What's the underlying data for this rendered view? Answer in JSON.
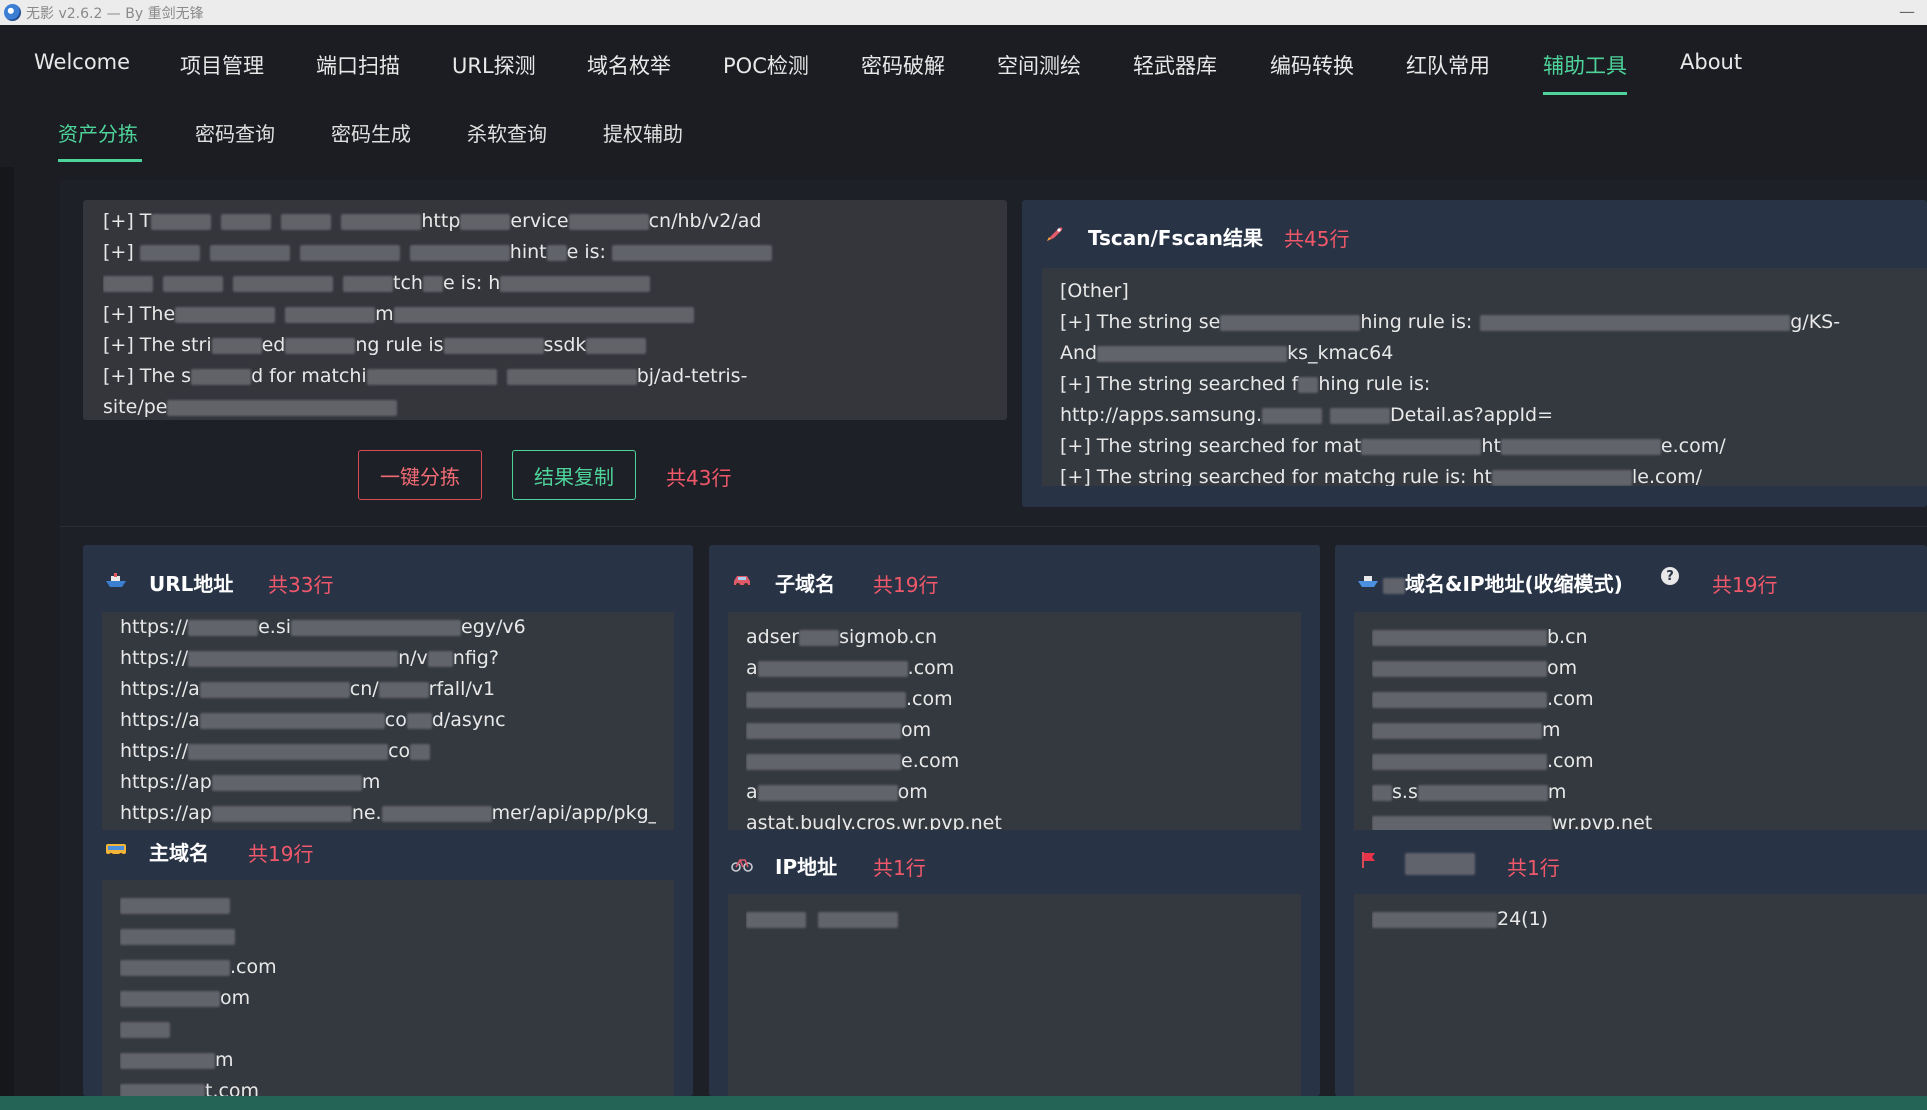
{
  "window": {
    "title": "无影 v2.6.2 — By 重剑无锋",
    "minimize": "—"
  },
  "topnav": {
    "items": [
      "Welcome",
      "项目管理",
      "端口扫描",
      "URL探测",
      "域名枚举",
      "POC检测",
      "密码破解",
      "空间测绘",
      "轻武器库",
      "编码转换",
      "红队常用",
      "辅助工具",
      "About"
    ],
    "active": "辅助工具"
  },
  "subnav": {
    "items": [
      "资产分拣",
      "密码查询",
      "密码生成",
      "杀软查询",
      "提权辅助"
    ],
    "active": "资产分拣"
  },
  "input": {
    "lines": [
      [
        "[+] T",
        "",
        "",
        "",
        "",
        "http",
        "",
        "ervice",
        "",
        "cn/hb/v2/ad"
      ],
      [
        "[+] ",
        "",
        "",
        "",
        "",
        "hint",
        "",
        "e is: ",
        ""
      ],
      [
        "",
        "",
        "",
        "",
        "tch",
        "",
        "e is: h",
        ""
      ],
      [
        "[+] ",
        "The",
        "",
        "",
        "m",
        ""
      ],
      [
        "[+] The stri",
        "",
        "ed",
        "",
        "ng rule is",
        "",
        "ssdk",
        ""
      ],
      [
        "[+] The s",
        "",
        "d for matchi",
        "",
        "",
        "bj/ad-tetris-"
      ],
      [
        "site/pe",
        ""
      ]
    ]
  },
  "actions": {
    "sort_label": "一键分拣",
    "copy_label": "结果复制",
    "count": "共43行"
  },
  "tscan": {
    "title": "Tscan/Fscan结果",
    "count": "共45行",
    "lines": [
      "[Other]",
      "[+] The string se",
      "hing rule is:",
      "g/KS-",
      "And",
      "ks_kmac64",
      "[+] The string searched f",
      "hing rule is:",
      "http://apps.samsung.",
      "Detail.as?appId=",
      "[+] The string searched for mat",
      "ht",
      "e.com/",
      "[+] The string searched for match",
      "g rule is: ht",
      "le.com/"
    ]
  },
  "panels": {
    "url": {
      "title": "URL地址",
      "count": "共33行",
      "lines": [
        [
          "https://",
          "e.si",
          "egy/v6"
        ],
        [
          "https://",
          "n/v",
          "nfig?"
        ],
        [
          "https://a",
          "cn/",
          "rfall/v1"
        ],
        [
          "https://a",
          "co",
          "d/async"
        ],
        [
          "https://",
          "co",
          ""
        ],
        [
          "https://ap",
          "",
          "m"
        ],
        [
          "https://ap",
          "ne.",
          "mer/api/app/pkg_inf"
        ]
      ]
    },
    "main_domain": {
      "title": "主域名",
      "count": "共19行",
      "lines": [
        [
          "",
          ""
        ],
        [
          "",
          ""
        ],
        [
          "",
          ".com"
        ],
        [
          "",
          "om"
        ],
        [
          "",
          ""
        ],
        [
          "",
          "m"
        ],
        [
          "",
          "t.com"
        ]
      ]
    },
    "subdomain": {
      "title": "子域名",
      "count": "共19行",
      "lines": [
        [
          "adser",
          "sigmob.cn"
        ],
        [
          "a",
          ".com"
        ],
        [
          "",
          ".com"
        ],
        [
          "",
          "om"
        ],
        [
          "",
          "e.com"
        ],
        [
          "a",
          "om"
        ],
        [
          "astat.bugly.cros.wr.pvp.net",
          ""
        ]
      ]
    },
    "ip": {
      "title": "IP地址",
      "count": "共1行",
      "lines": [
        [
          "",
          ""
        ]
      ]
    },
    "domain_ip": {
      "title": "域名&IP地址(收缩模式)",
      "count": "共19行",
      "help": "?",
      "lines": [
        [
          "",
          "b.cn"
        ],
        [
          "",
          "om"
        ],
        [
          "",
          ".com"
        ],
        [
          "",
          "m"
        ],
        [
          "",
          ".com"
        ],
        [
          "s.s",
          "m"
        ],
        [
          "",
          "wr.pvp.net"
        ]
      ]
    },
    "flag": {
      "title": "",
      "count": "共1行",
      "lines": [
        [
          "",
          "24(1)"
        ]
      ]
    }
  },
  "icons": {
    "app": "app-logo-icon",
    "rocket": "rocket-icon",
    "ship": "ship-icon",
    "bus": "bus-icon",
    "car": "car-icon",
    "bike": "bicycle-icon",
    "boat": "boat-icon",
    "flag": "flag-icon"
  },
  "colors": {
    "accent_green": "#4ed39a",
    "count_red": "#f0586a",
    "panel_bg": "#283446"
  }
}
